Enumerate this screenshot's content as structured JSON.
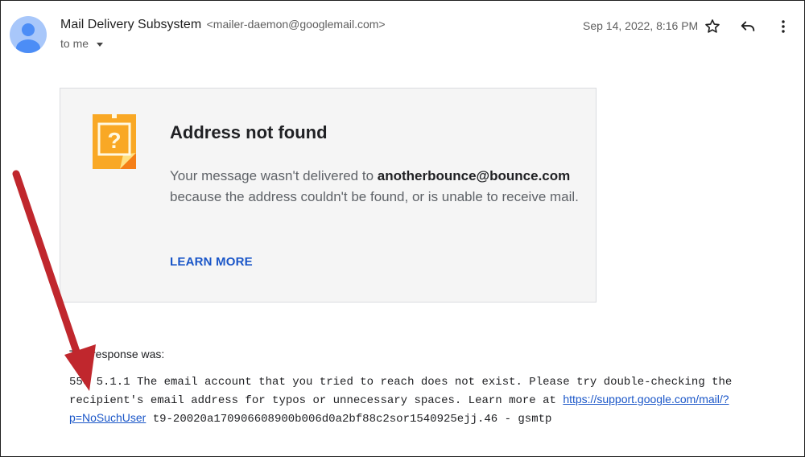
{
  "header": {
    "sender_name": "Mail Delivery Subsystem",
    "sender_email": "<mailer-daemon@googlemail.com>",
    "recipient": "to me",
    "date": "Sep 14, 2022, 8:16 PM",
    "icons": {
      "avatar": "person-avatar-icon",
      "star": "star-outline-icon",
      "reply": "reply-icon",
      "more": "more-vertical-icon",
      "recipient_toggle": "caret-down-icon"
    }
  },
  "card": {
    "icon": "document-question-icon",
    "title": "Address not found",
    "message_prefix": "Your message wasn't delivered to ",
    "address": "anotherbounce@bounce.com",
    "message_suffix": " because the address couldn't be found, or is unable to receive mail.",
    "learn_more": "LEARN MORE"
  },
  "response": {
    "label": "The response was:",
    "text_prefix": "550 5.1.1 The email account that you tried to reach does not exist. Please try double-checking the recipient's email address for typos or unnecessary spaces. Learn more at ",
    "link": "https://support.google.com/mail/?p=NoSuchUser",
    "text_suffix": " t9-20020a170906608900b006d0a2bf88c2sor1540925ejj.46 - gsmtp"
  },
  "colors": {
    "accent_link": "#1a56c8",
    "icon_orange": "#f9a825",
    "arrow_red": "#c0272d"
  }
}
